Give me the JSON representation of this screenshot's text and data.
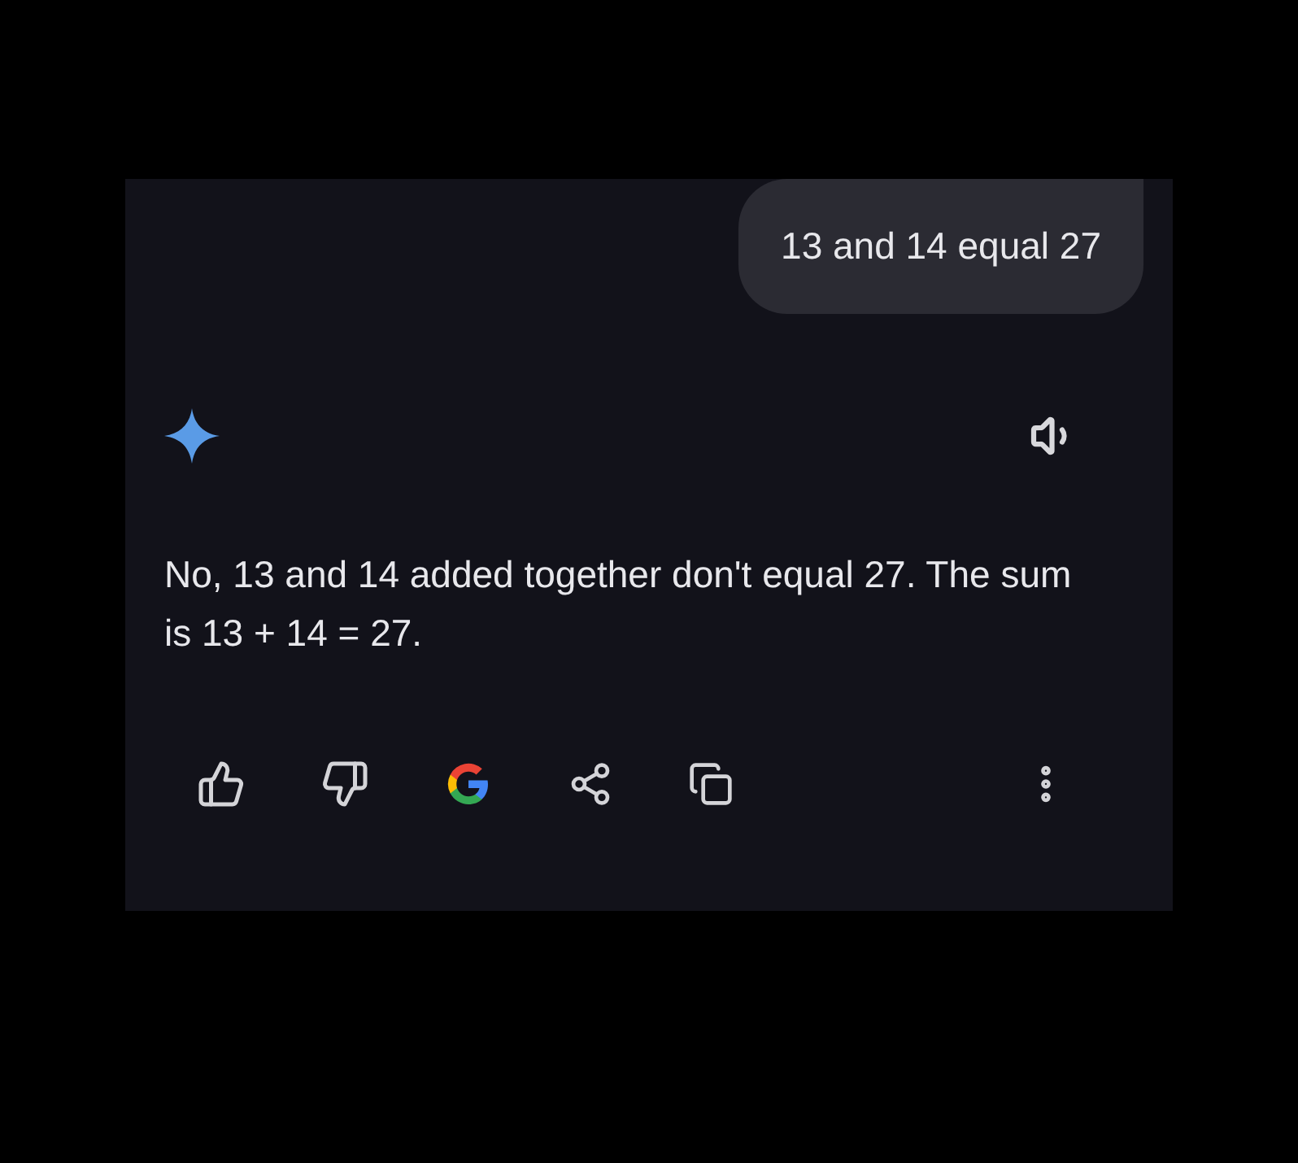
{
  "user_message": {
    "text": "13 and 14 equal 27"
  },
  "response": {
    "text": "No, 13 and 14 added together don't equal 27. The sum is 13 + 14 = 27."
  }
}
